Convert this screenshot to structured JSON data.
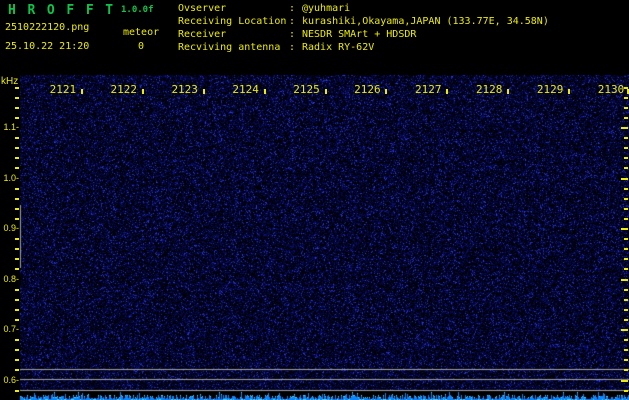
{
  "app": {
    "title": "H R O F F T",
    "version": "1.0.0f"
  },
  "header": {
    "filename": "2510222120.png",
    "datetime": "25.10.22 21:20",
    "counter": {
      "label": "meteor",
      "value": "0"
    },
    "info": [
      {
        "label": "Ovserver",
        "sep": ":",
        "value": "@yuhmari"
      },
      {
        "label": "Receiving Location",
        "sep": ":",
        "value": "kurashiki,Okayama,JAPAN (133.77E, 34.58N)"
      },
      {
        "label": "Receiver",
        "sep": ":",
        "value": "NESDR SMArt + HDSDR"
      },
      {
        "label": "Recviving antenna",
        "sep": ":",
        "value": "Radix RY-62V"
      }
    ]
  },
  "chart_data": {
    "type": "heatmap",
    "subtype": "radio_meteor_spectrogram",
    "title": "HROFFT 10-minute spectrogram 21:20-21:30, 25.10.22",
    "ylabel": "kHz",
    "x_ticks": [
      "2121",
      "2122",
      "2123",
      "2124",
      "2125",
      "2126",
      "2127",
      "2128",
      "2129",
      "2130"
    ],
    "y_ticks": [
      "1.1",
      "1.0",
      "0.9",
      "0.8",
      "0.7",
      "0.6"
    ],
    "y_range_khz": [
      0.58,
      1.2
    ],
    "x_span_minutes": 10,
    "grid": false,
    "legend": "none",
    "meteor_count": 0,
    "echoes": [],
    "carrier_lines_khz": [
      0.622,
      0.602,
      0.582
    ],
    "left_edge_artifact_khz": [
      0.823,
      0.947
    ],
    "noise_floor": "uniform dim blue speckle background, no meteor echoes visible",
    "signal_level_strip": "bright blue band at bottom shows received signal level vs time"
  },
  "colors": {
    "background": "#000000",
    "text_yellow": "#ecec00",
    "title_green": "#0cc54a",
    "carrier_gray": "#a2a2a2",
    "artifact_gray": "#9aa2ac",
    "strip_blue": "#0c86ff",
    "strip_cyan": "#52d2ff"
  }
}
